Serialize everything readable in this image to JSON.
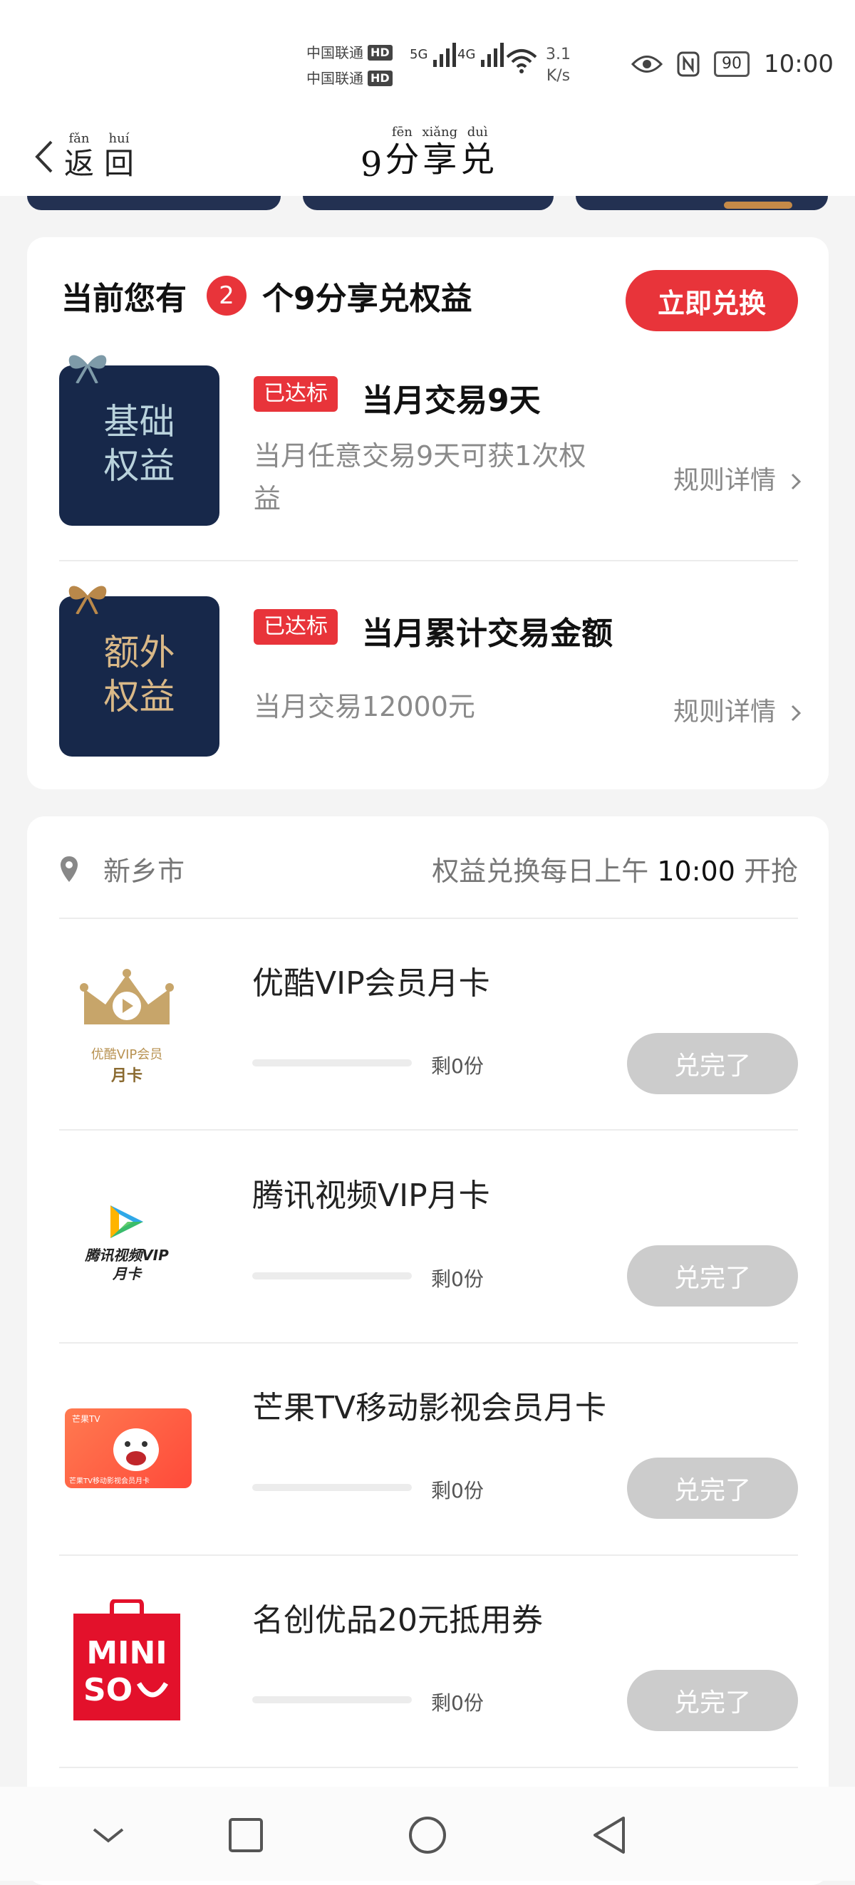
{
  "status_bar": {
    "carrier_1": "中国联通",
    "carrier_2": "中国联通",
    "hd": "HD",
    "net_1": "5G",
    "net_2": "4G",
    "speed_value": "3.1",
    "speed_unit": "K/s",
    "battery": "90",
    "time": "10:00"
  },
  "nav": {
    "back_chars": [
      {
        "ch": "返",
        "py": "fǎn"
      },
      {
        "ch": "回",
        "py": "huí"
      }
    ],
    "title_prefix": "9",
    "title_chars": [
      {
        "ch": "分",
        "py": "fēn"
      },
      {
        "ch": "享",
        "py": "xiǎng"
      },
      {
        "ch": "兑",
        "py": "duì"
      }
    ]
  },
  "rights": {
    "prefix": "当前您有",
    "count": "2",
    "suffix": "个9分享兑权益",
    "redeem_label": "立即兑换",
    "items": [
      {
        "image_text_1": "基础",
        "image_text_2": "权益",
        "status": "已达标",
        "title": "当月交易9天",
        "desc": "当月任意交易9天可获1次权益",
        "rule": "规则详情"
      },
      {
        "image_text_1": "额外",
        "image_text_2": "权益",
        "status": "已达标",
        "title": "当月累计交易金额",
        "desc": "当月交易12000元",
        "rule": "规则详情"
      }
    ]
  },
  "exchange": {
    "city": "新乡市",
    "rule_text": "权益兑换每日上午",
    "rule_time": "10:00",
    "rule_suffix": "开抢",
    "products": [
      {
        "name": "优酷VIP会员月卡",
        "remain": "剩0份",
        "button": "兑完了",
        "thumb_line1": "优酷VIP会员",
        "thumb_line2": "月卡",
        "remaining_fraction": 0
      },
      {
        "name": "腾讯视频VIP月卡",
        "remain": "剩0份",
        "button": "兑完了",
        "thumb_line1": "腾讯视频VIP",
        "thumb_line2": "月卡",
        "remaining_fraction": 0
      },
      {
        "name": "芒果TV移动影视会员月卡",
        "remain": "剩0份",
        "button": "兑完了",
        "thumb_line1": "芒果TV",
        "thumb_line2": "芒果TV移动影视会员月卡",
        "remaining_fraction": 0
      },
      {
        "name": "名创优品20元抵用券",
        "remain": "剩0份",
        "button": "兑完了",
        "thumb_line1": "MINI",
        "thumb_line2": "SO",
        "remaining_fraction": 0
      }
    ]
  },
  "icons": [
    "back-chevron-icon",
    "location-pin-icon",
    "chevron-right-icon",
    "eye-icon",
    "nfc-icon",
    "wifi-icon",
    "signal-icon",
    "nav-back-icon",
    "nav-home-icon",
    "nav-recents-icon",
    "nav-collapse-icon"
  ],
  "colors": {
    "accent": "#e8343a",
    "card_bg": "#ffffff",
    "page_bg": "#f4f4f4",
    "banner_navy": "#17284a",
    "disabled": "#cccccc"
  }
}
